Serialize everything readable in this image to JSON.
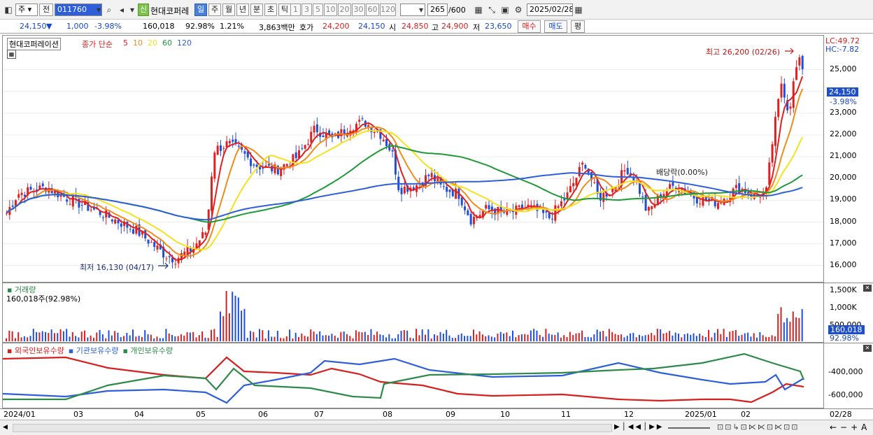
{
  "toolbar": {
    "market_select": "주",
    "prev_label": "전",
    "code_value": "011760",
    "stock_badge": "신",
    "stock_name": "현대코퍼레",
    "periods": [
      "일",
      "주",
      "월",
      "년",
      "분",
      "초",
      "틱"
    ],
    "active_period": "일",
    "minute_values": [
      "1",
      "3",
      "5",
      "10",
      "20",
      "30",
      "60",
      "120"
    ],
    "count_display": "265",
    "count_total": "/600",
    "date_value": "2025/02/28"
  },
  "quote": {
    "price": "24,150",
    "change_arrow": "▼",
    "change": "1,000",
    "change_pct": "-3.98%",
    "volume": "160,018",
    "volume_ratio": "92.98%",
    "turnover": "1.21%",
    "amount": "3,863백만",
    "ask_label": "호가",
    "ask1": "24,200",
    "bid1": "24,150",
    "open_label": "시",
    "open": "24,850",
    "high_label": "고",
    "high": "24,900",
    "low_label": "저",
    "low": "23,650",
    "buy_label": "매수",
    "sell_label": "매도",
    "eval_label": "평"
  },
  "price_panel": {
    "legend_name": "현대코퍼레이션",
    "legend_title": "종가 단순",
    "ma_periods": [
      "5",
      "10",
      "20",
      "60",
      "120"
    ],
    "ma_colors": [
      "#e02020",
      "#f08c1c",
      "#f5e21e",
      "#1f9a3a",
      "#2f5fd8"
    ],
    "high_note": "최고 26,200 (02/26)",
    "low_note": "최저 16,130 (04/17)",
    "dividend_note": "배당락(0.00%)",
    "lc_label": "LC:49.72",
    "hc_label": "HC:-7.82",
    "current_price_tag": "24,150",
    "current_pct_tag": "-3.98%",
    "y_ticks": [
      "25,000",
      "24,000",
      "23,000",
      "22,000",
      "21,000",
      "20,000",
      "19,000",
      "18,000",
      "17,000",
      "16,000"
    ]
  },
  "volume_panel": {
    "legend": "거래량",
    "value_text": "160,018주(92.98%)",
    "y_ticks": [
      "1,500K",
      "1,000K",
      "500,000"
    ],
    "current_tag": "160,018",
    "current_pct": "92.98%"
  },
  "holding_panel": {
    "legends": [
      "외국인보유수량",
      "기관보유수량",
      "개인보유수량"
    ],
    "legend_colors": [
      "#d62020",
      "#2f5fd8",
      "#2e8a4a"
    ],
    "y_ticks": [
      "-400,000",
      "-600,000"
    ]
  },
  "x_axis": {
    "labels": [
      "2024/01",
      "03",
      "04",
      "05",
      "06",
      "07",
      "08",
      "09",
      "10",
      "11",
      "12",
      "2025/01",
      "02"
    ],
    "end_label": "02/28"
  },
  "chart_data": {
    "type": "candlestick",
    "title": "현대코퍼레이션",
    "x_range": [
      "2024/01",
      "2025/02/28"
    ],
    "ylim": [
      15700,
      26500
    ],
    "annotations": [
      {
        "text": "최고 26,200 (02/26)",
        "value": 26200,
        "date": "02/26"
      },
      {
        "text": "최저 16,130 (04/17)",
        "value": 16130,
        "date": "04/17"
      }
    ],
    "last_close": 24150,
    "moving_averages": [
      5,
      10,
      20,
      60,
      120
    ]
  }
}
